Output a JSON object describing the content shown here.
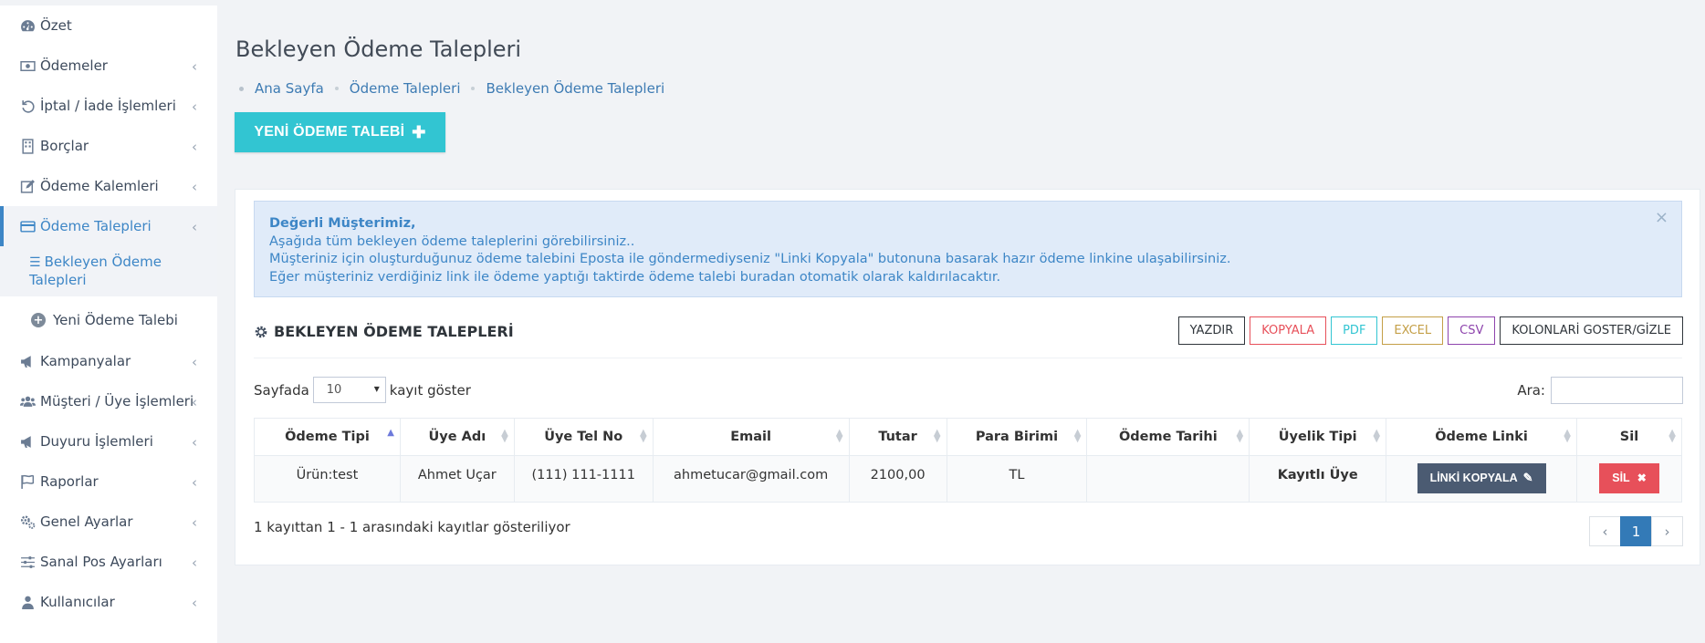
{
  "sidebar": {
    "items": [
      {
        "label": "Özet",
        "icon": "dashboard-icon",
        "chevron": false
      },
      {
        "label": "Ödemeler",
        "icon": "money-icon",
        "chevron": true
      },
      {
        "label": "İptal / İade İşlemleri",
        "icon": "undo-icon",
        "chevron": true
      },
      {
        "label": "Borçlar",
        "icon": "building-icon",
        "chevron": true
      },
      {
        "label": "Ödeme Kalemleri",
        "icon": "edit-icon",
        "chevron": true
      },
      {
        "label": "Ödeme Talepleri",
        "icon": "credit-card-icon",
        "chevron": true,
        "active": true
      }
    ],
    "subitems": [
      {
        "label": "Bekleyen Ödeme Talepleri",
        "icon": "list-icon",
        "active": true
      },
      {
        "label": "Yeni Ödeme Talebi",
        "icon": "plus-circle-icon"
      }
    ],
    "items2": [
      {
        "label": "Kampanyalar",
        "icon": "bullhorn-icon"
      },
      {
        "label": "Müşteri / Üye İşlemleri",
        "icon": "users-icon"
      },
      {
        "label": "Duyuru İşlemleri",
        "icon": "bullhorn-icon"
      },
      {
        "label": "Raporlar",
        "icon": "flag-icon"
      },
      {
        "label": "Genel Ayarlar",
        "icon": "cogs-icon"
      },
      {
        "label": "Sanal Pos Ayarları",
        "icon": "sliders-icon"
      },
      {
        "label": "Kullanıcılar",
        "icon": "user-icon"
      }
    ]
  },
  "page": {
    "title": "Bekleyen Ödeme Talepleri",
    "breadcrumb": [
      "Ana Sayfa",
      "Ödeme Talepleri",
      "Bekleyen Ödeme Talepleri"
    ],
    "new_button": "YENİ ÖDEME TALEBİ"
  },
  "alert": {
    "heading": "Değerli Müşterimiz,",
    "lines": [
      "Aşağıda tüm bekleyen ödeme taleplerini görebilirsiniz..",
      "Müşteriniz için oluşturduğunuz ödeme talebini Eposta ile göndermediyseniz \"Linki Kopyala\" butonuna basarak hazır ödeme linkine ulaşabilirsiniz.",
      "Eğer müşteriniz verdiğiniz link ile ödeme yaptığı taktirde ödeme talebi buradan otomatik olarak kaldırılacaktır."
    ],
    "close": "×"
  },
  "section": {
    "title": "BEKLEYEN ÖDEME TALEPLERİ",
    "toolbar": [
      "YAZDIR",
      "KOPYALA",
      "PDF",
      "EXCEL",
      "CSV",
      "KOLONLARİ GOSTER/GİZLE"
    ]
  },
  "length": {
    "prefix": "Sayfada",
    "value": "10",
    "suffix": "kayıt göster"
  },
  "search": {
    "label": "Ara:"
  },
  "table": {
    "headers": [
      "Ödeme Tipi",
      "Üye Adı",
      "Üye Tel No",
      "Email",
      "Tutar",
      "Para Birimi",
      "Ödeme Tarihi",
      "Üyelik Tipi",
      "Ödeme Linki",
      "Sil"
    ],
    "rows": [
      {
        "tip": "Ürün:test",
        "ad": "Ahmet Uçar",
        "tel": "(111) 111-1111",
        "email": "ahmetucar@gmail.com",
        "tutar": "2100,00",
        "para": "TL",
        "tarih": "",
        "uyelik": "Kayıtlı Üye",
        "link_label": "LİNKİ KOPYALA",
        "del_label": "SİL"
      }
    ]
  },
  "info": "1 kayıttan 1 - 1 arasındaki kayıtlar gösteriliyor",
  "pager": {
    "prev": "‹",
    "current": "1",
    "next": "›"
  }
}
